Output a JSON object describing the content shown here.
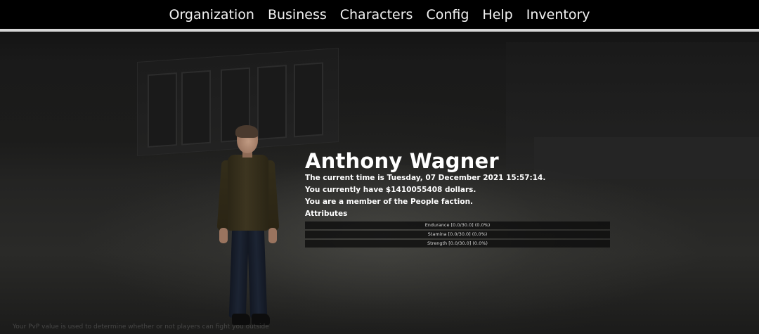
{
  "menu": {
    "items": [
      {
        "label": "Organization"
      },
      {
        "label": "Business"
      },
      {
        "label": "Characters"
      },
      {
        "label": "Config"
      },
      {
        "label": "Help"
      },
      {
        "label": "Inventory"
      }
    ]
  },
  "character": {
    "name": "Anthony Wagner",
    "time_line": "The current time is Tuesday, 07 December 2021 15:57:14.",
    "money_line": "You currently have $1410055408 dollars.",
    "faction_line": "You are a member of the People faction.",
    "attributes_heading": "Attributes",
    "attributes": [
      {
        "label": "Endurance [0.0/30.0] (0.0%)"
      },
      {
        "label": "Stamina [0.0/30.0] (0.0%)"
      },
      {
        "label": "Strength [0.0/30.0] (0.0%)"
      }
    ]
  },
  "footer": {
    "note": "Your PvP value is used to determine whether or not players can fight you outside"
  }
}
